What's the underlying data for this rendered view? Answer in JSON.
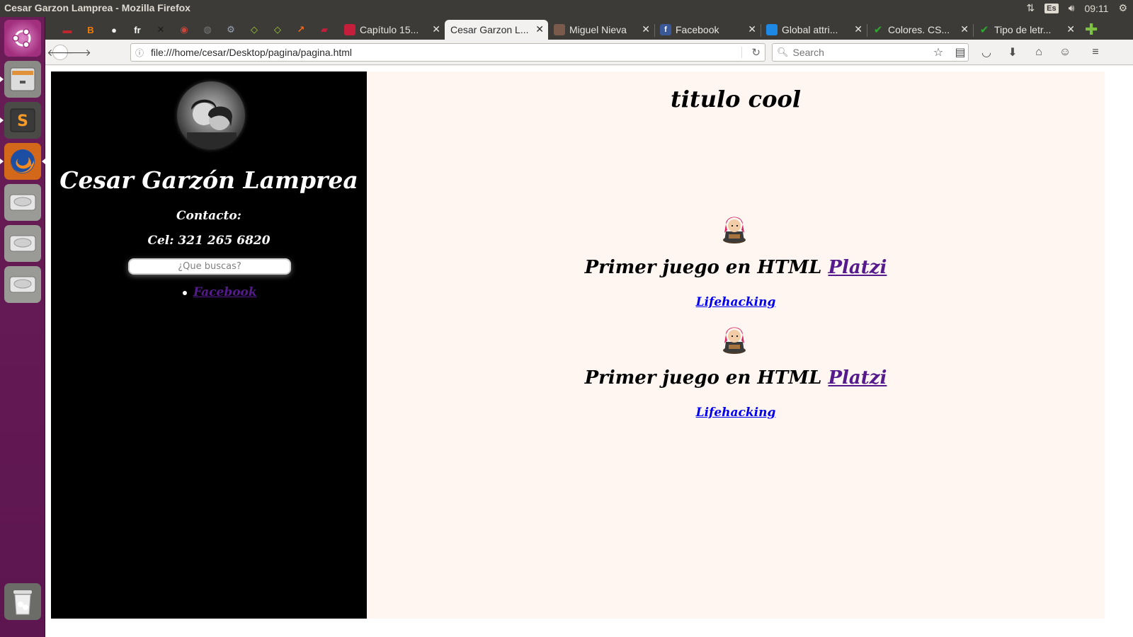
{
  "system": {
    "window_title": "Cesar Garzon Lamprea - Mozilla Firefox",
    "keyboard_layout": "Es",
    "clock": "09:11"
  },
  "launcher": {
    "items": [
      {
        "name": "ubuntu-dash",
        "icon": "ubuntu-logo-icon"
      },
      {
        "name": "files",
        "icon": "file-cabinet-icon"
      },
      {
        "name": "sublime-text",
        "icon": "sublime-text-icon"
      },
      {
        "name": "firefox",
        "icon": "firefox-icon"
      },
      {
        "name": "drive-1",
        "icon": "hard-drive-icon"
      },
      {
        "name": "drive-2",
        "icon": "hard-drive-icon"
      },
      {
        "name": "drive-3",
        "icon": "hard-drive-icon"
      },
      {
        "name": "trash",
        "icon": "trash-icon"
      }
    ]
  },
  "browser": {
    "pinned_tabs": [
      {
        "icon": "flag-icon",
        "color": "#c0272d"
      },
      {
        "icon": "blogger-icon",
        "color": "#f57d00"
      },
      {
        "icon": "github-icon",
        "color": "#f2f1f0"
      },
      {
        "icon": "freecodecamp-icon",
        "color": "#ffffff"
      },
      {
        "icon": "x-icon",
        "color": "#1a1a1a"
      },
      {
        "icon": "brain-icon",
        "color": "#c9453d"
      },
      {
        "icon": "globe-icon",
        "color": "#777777"
      },
      {
        "icon": "gear-icon",
        "color": "#9aa6b8"
      },
      {
        "icon": "diamond-icon",
        "color": "#9acd32"
      },
      {
        "icon": "diamond-icon",
        "color": "#9acd32"
      },
      {
        "icon": "chart-icon",
        "color": "#f26b1d"
      },
      {
        "icon": "book-icon",
        "color": "#c41e3a"
      }
    ],
    "tabs": [
      {
        "label": "Capítulo 15...",
        "icon": "book-icon",
        "color": "#c41e3a"
      },
      {
        "label": "Cesar Garzon L...",
        "icon": "",
        "color": "",
        "active": true
      },
      {
        "label": "Miguel Nieva",
        "icon": "avatar-icon",
        "color": "#7a5a4a"
      },
      {
        "label": "Facebook",
        "icon": "facebook-icon",
        "color": "#3b5998"
      },
      {
        "label": "Global attri...",
        "icon": "mdn-icon",
        "color": "#1e88e5"
      },
      {
        "label": "Colores. CS...",
        "icon": "checkmark-icon",
        "color": "#2eaa2e"
      },
      {
        "label": "Tipo de letr...",
        "icon": "checkmark-icon",
        "color": "#2eaa2e"
      }
    ],
    "url": "file:///home/cesar/Desktop/pagina/pagina.html",
    "search_placeholder": "Search"
  },
  "page": {
    "sidebar": {
      "name": "Cesar Garzón Lamprea",
      "contact_label": "Contacto:",
      "phone": "Cel: 321 265 6820",
      "search_placeholder": "¿Que buscas?",
      "links": [
        "Facebook"
      ]
    },
    "main": {
      "title": "titulo cool",
      "games": [
        {
          "heading": "Primer juego en HTML",
          "link": "Platzi",
          "sublink": "Lifehacking"
        },
        {
          "heading": "Primer juego en HTML",
          "link": "Platzi",
          "sublink": "Lifehacking"
        }
      ]
    },
    "colors": {
      "sidebar_bg": "#000000",
      "main_bg": "#fff6f1",
      "visited_link": "#551a8b",
      "link": "#0000ee"
    }
  }
}
